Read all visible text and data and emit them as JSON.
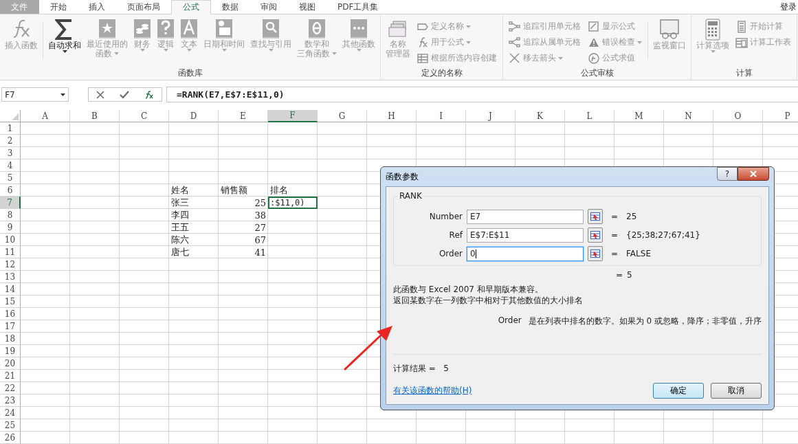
{
  "tabs": [
    {
      "label": "文件",
      "kind": "file",
      "selected": false
    },
    {
      "label": "开始",
      "kind": "tab",
      "selected": false
    },
    {
      "label": "插入",
      "kind": "tab",
      "selected": false
    },
    {
      "label": "页面布局",
      "kind": "tab",
      "selected": false
    },
    {
      "label": "公式",
      "kind": "tab",
      "selected": true
    },
    {
      "label": "数据",
      "kind": "tab",
      "selected": false
    },
    {
      "label": "审阅",
      "kind": "tab",
      "selected": false
    },
    {
      "label": "视图",
      "kind": "tab",
      "selected": false
    },
    {
      "label": "PDF工具集",
      "kind": "tab",
      "selected": false
    }
  ],
  "login": "登录",
  "ribbon": [
    {
      "label": "函数库",
      "columns": [
        {
          "kind": "large",
          "items": [
            {
              "lines": [
                "插入函数"
              ],
              "dropdown": false,
              "disabled": true
            }
          ]
        },
        {
          "kind": "divider"
        },
        {
          "kind": "large",
          "items": [
            {
              "lines": [
                "自动求和"
              ],
              "dropdown": true,
              "disabled": false
            }
          ]
        },
        {
          "kind": "large",
          "items": [
            {
              "lines": [
                "最近使用的",
                "函数"
              ],
              "dropdown": true,
              "disabled": true
            }
          ]
        },
        {
          "kind": "large",
          "items": [
            {
              "lines": [
                "财务"
              ],
              "dropdown": true,
              "disabled": true
            }
          ]
        },
        {
          "kind": "large",
          "items": [
            {
              "lines": [
                "逻辑"
              ],
              "dropdown": true,
              "disabled": true
            }
          ]
        },
        {
          "kind": "large",
          "items": [
            {
              "lines": [
                "文本"
              ],
              "dropdown": true,
              "disabled": true
            }
          ]
        },
        {
          "kind": "large",
          "items": [
            {
              "lines": [
                "日期和时间"
              ],
              "dropdown": true,
              "disabled": true
            }
          ]
        },
        {
          "kind": "large",
          "items": [
            {
              "lines": [
                "查找与引用"
              ],
              "dropdown": true,
              "disabled": true
            }
          ]
        },
        {
          "kind": "large",
          "items": [
            {
              "lines": [
                "数学和",
                "三角函数"
              ],
              "dropdown": true,
              "disabled": true
            }
          ]
        },
        {
          "kind": "large",
          "items": [
            {
              "lines": [
                "其他函数"
              ],
              "dropdown": true,
              "disabled": true
            }
          ]
        }
      ]
    },
    {
      "label": "定义的名称",
      "columns": [
        {
          "kind": "large",
          "items": [
            {
              "lines": [
                "名称",
                "管理器"
              ],
              "dropdown": false,
              "disabled": true
            }
          ]
        },
        {
          "kind": "small",
          "items": [
            {
              "lines": [
                "定义名称"
              ],
              "dropdown": true,
              "disabled": true
            },
            {
              "lines": [
                "用于公式"
              ],
              "dropdown": true,
              "disabled": true
            },
            {
              "lines": [
                "根据所选内容创建"
              ],
              "dropdown": false,
              "disabled": true
            }
          ]
        }
      ]
    },
    {
      "label": "公式审核",
      "columns": [
        {
          "kind": "small",
          "items": [
            {
              "lines": [
                "追踪引用单元格"
              ],
              "dropdown": false,
              "disabled": true
            },
            {
              "lines": [
                "追踪从属单元格"
              ],
              "dropdown": false,
              "disabled": true
            },
            {
              "lines": [
                "移去箭头"
              ],
              "dropdown": true,
              "disabled": true
            }
          ]
        },
        {
          "kind": "small",
          "items": [
            {
              "lines": [
                "显示公式"
              ],
              "dropdown": false,
              "disabled": true
            },
            {
              "lines": [
                "错误检查"
              ],
              "dropdown": true,
              "disabled": true
            },
            {
              "lines": [
                "公式求值"
              ],
              "dropdown": false,
              "disabled": true
            }
          ]
        },
        {
          "kind": "divider"
        },
        {
          "kind": "large",
          "items": [
            {
              "lines": [
                "监视窗口"
              ],
              "dropdown": false,
              "disabled": true
            }
          ]
        }
      ]
    },
    {
      "label": "计算",
      "columns": [
        {
          "kind": "large",
          "items": [
            {
              "lines": [
                "计算选项"
              ],
              "dropdown": true,
              "disabled": true
            }
          ]
        },
        {
          "kind": "small",
          "items": [
            {
              "lines": [
                "开始计算"
              ],
              "dropdown": false,
              "disabled": true
            },
            {
              "lines": [
                "计算工作表"
              ],
              "dropdown": false,
              "disabled": true
            }
          ]
        }
      ]
    }
  ],
  "formula_bar": {
    "name_box": "F7",
    "formula": "=RANK(E7,E$7:E$11,0)"
  },
  "sheet": {
    "columns": [
      {
        "label": "A",
        "selected": false
      },
      {
        "label": "B",
        "selected": false
      },
      {
        "label": "C",
        "selected": false
      },
      {
        "label": "D",
        "selected": false
      },
      {
        "label": "E",
        "selected": false
      },
      {
        "label": "F",
        "selected": true
      },
      {
        "label": "G",
        "selected": false
      },
      {
        "label": "H",
        "selected": false
      },
      {
        "label": "I",
        "selected": false
      },
      {
        "label": "J",
        "selected": false
      },
      {
        "label": "K",
        "selected": false
      },
      {
        "label": "L",
        "selected": false
      },
      {
        "label": "M",
        "selected": false
      },
      {
        "label": "N",
        "selected": false
      },
      {
        "label": "O",
        "selected": false
      },
      {
        "label": "P",
        "selected": false
      }
    ],
    "rows": [
      {
        "header": "1",
        "selected": false
      },
      {
        "header": "2",
        "selected": false
      },
      {
        "header": "3",
        "selected": false
      },
      {
        "header": "4",
        "selected": false
      },
      {
        "header": "5",
        "selected": false
      },
      {
        "header": "6",
        "selected": false,
        "cells": [
          {
            "text": "姓名",
            "kind": "text"
          },
          {
            "text": "销售额",
            "kind": "text"
          },
          {
            "text": "排名",
            "kind": "text"
          }
        ]
      },
      {
        "header": "7",
        "selected": true,
        "cells": [
          {
            "text": "张三",
            "kind": "text"
          },
          {
            "text": "25",
            "kind": "number"
          },
          {
            "text": ":$11,0)",
            "kind": "edit"
          }
        ]
      },
      {
        "header": "8",
        "selected": false,
        "cells": [
          {
            "text": "李四",
            "kind": "text"
          },
          {
            "text": "38",
            "kind": "number"
          }
        ]
      },
      {
        "header": "9",
        "selected": false,
        "cells": [
          {
            "text": "王五",
            "kind": "text"
          },
          {
            "text": "27",
            "kind": "number"
          }
        ]
      },
      {
        "header": "10",
        "selected": false,
        "cells": [
          {
            "text": "陈六",
            "kind": "text"
          },
          {
            "text": "67",
            "kind": "number"
          }
        ]
      },
      {
        "header": "11",
        "selected": false,
        "cells": [
          {
            "text": "唐七",
            "kind": "text"
          },
          {
            "text": "41",
            "kind": "number"
          }
        ]
      },
      {
        "header": "12",
        "selected": false
      },
      {
        "header": "13",
        "selected": false
      },
      {
        "header": "14",
        "selected": false
      },
      {
        "header": "15",
        "selected": false
      },
      {
        "header": "16",
        "selected": false
      },
      {
        "header": "17",
        "selected": false
      },
      {
        "header": "18",
        "selected": false
      },
      {
        "header": "19",
        "selected": false
      },
      {
        "header": "20",
        "selected": false
      },
      {
        "header": "21",
        "selected": false
      },
      {
        "header": "22",
        "selected": false
      },
      {
        "header": "23",
        "selected": false
      },
      {
        "header": "24",
        "selected": false
      },
      {
        "header": "25",
        "selected": false
      },
      {
        "header": "26",
        "selected": false
      }
    ]
  },
  "dialog": {
    "title": "函数参数",
    "help_button": "?",
    "function": "RANK",
    "arguments": [
      {
        "label": "Number",
        "value": "E7",
        "equals": "=",
        "result": "25",
        "focused": false
      },
      {
        "label": "Ref",
        "value": "E$7:E$11",
        "equals": "=",
        "result": "{25;38;27;67;41}",
        "focused": false
      },
      {
        "label": "Order",
        "value": "0",
        "equals": "=",
        "result": "FALSE",
        "focused": true
      }
    ],
    "formula_result": {
      "equals": "=",
      "value": "5"
    },
    "description": [
      "此函数与 Excel 2007 和早期版本兼容。",
      "返回某数字在一列数字中相对于其他数值的大小排名"
    ],
    "argument_help": {
      "name": "Order",
      "text": "是在列表中排名的数字。如果为 0 或忽略，降序；非零值，升序"
    },
    "result_label": "计算结果 =",
    "result_value": "5",
    "help_link": "有关该函数的帮助(H)",
    "buttons": [
      {
        "label": "确定",
        "default": true
      },
      {
        "label": "取消",
        "default": false
      }
    ]
  }
}
